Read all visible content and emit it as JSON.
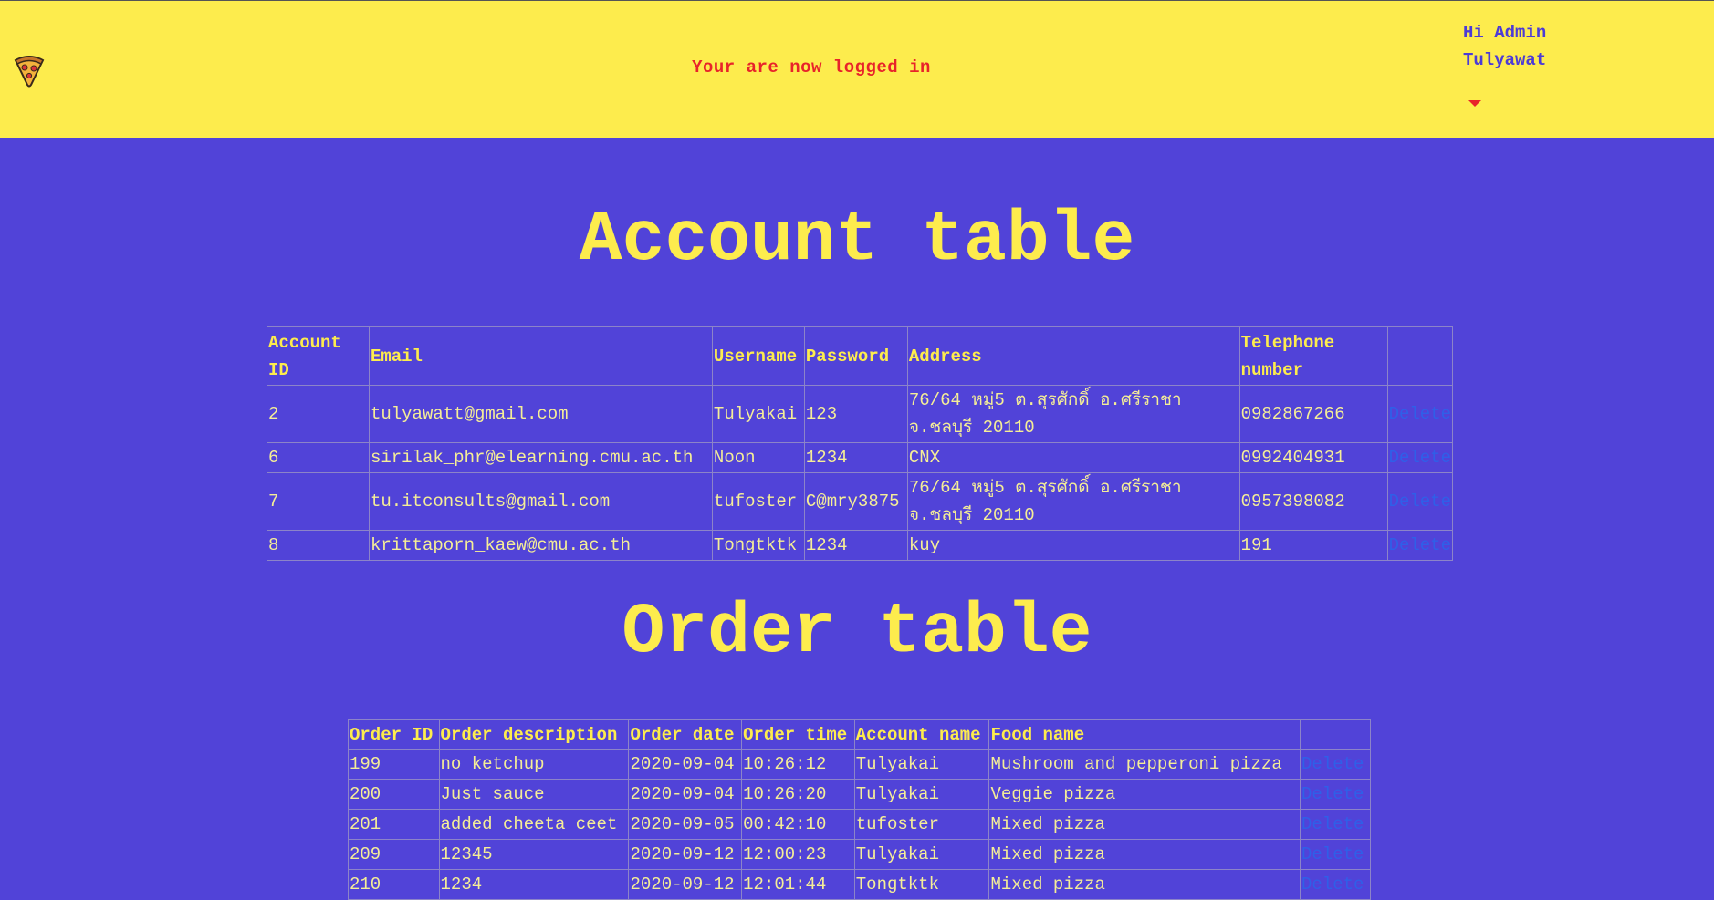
{
  "header": {
    "status_message": "Your are now logged in",
    "greeting": "Hi Admin",
    "username": "Tulyawat",
    "logo_icon": "pizza-icon",
    "background_color": "#fdec4d",
    "status_color": "#e8232a"
  },
  "account_section": {
    "title": "Account table",
    "columns": [
      "Account ID",
      "Email",
      "Username",
      "Password",
      "Address",
      "Telephone number",
      ""
    ],
    "rows": [
      {
        "id": "2",
        "email": "tulyawatt@gmail.com",
        "username": "Tulyakai",
        "password": "123",
        "address": "76/64 หมู่5 ต.สุรศักดิ์ อ.ศรีราชา จ.ชลบุรี 20110",
        "phone": "0982867266",
        "action": "Delete"
      },
      {
        "id": "6",
        "email": "sirilak_phr@elearning.cmu.ac.th",
        "username": "Noon",
        "password": "1234",
        "address": "CNX",
        "phone": "0992404931",
        "action": "Delete"
      },
      {
        "id": "7",
        "email": "tu.itconsults@gmail.com",
        "username": "tufoster",
        "password": "C@mry3875",
        "address": "76/64 หมู่5 ต.สุรศักดิ์ อ.ศรีราชา จ.ชลบุรี 20110",
        "phone": "0957398082",
        "action": "Delete"
      },
      {
        "id": "8",
        "email": "krittaporn_kaew@cmu.ac.th",
        "username": "Tongtktk",
        "password": "1234",
        "address": "kuy",
        "phone": "191",
        "action": "Delete"
      }
    ]
  },
  "order_section": {
    "title": "Order table",
    "columns": [
      "Order ID",
      "Order description",
      "Order date",
      "Order time",
      "Account name",
      "Food name",
      ""
    ],
    "rows": [
      {
        "id": "199",
        "description": "no ketchup",
        "date": "2020-09-04",
        "time": "10:26:12",
        "account": "Tulyakai",
        "food": "Mushroom and pepperoni pizza",
        "action": "Delete"
      },
      {
        "id": "200",
        "description": "Just sauce",
        "date": "2020-09-04",
        "time": "10:26:20",
        "account": "Tulyakai",
        "food": "Veggie pizza",
        "action": "Delete"
      },
      {
        "id": "201",
        "description": "added cheeta ceet",
        "date": "2020-09-05",
        "time": "00:42:10",
        "account": "tufoster",
        "food": "Mixed pizza",
        "action": "Delete"
      },
      {
        "id": "209",
        "description": "12345",
        "date": "2020-09-12",
        "time": "12:00:23",
        "account": "Tulyakai",
        "food": "Mixed pizza",
        "action": "Delete"
      },
      {
        "id": "210",
        "description": "1234",
        "date": "2020-09-12",
        "time": "12:01:44",
        "account": "Tongtktk",
        "food": "Mixed pizza",
        "action": "Delete"
      }
    ]
  }
}
